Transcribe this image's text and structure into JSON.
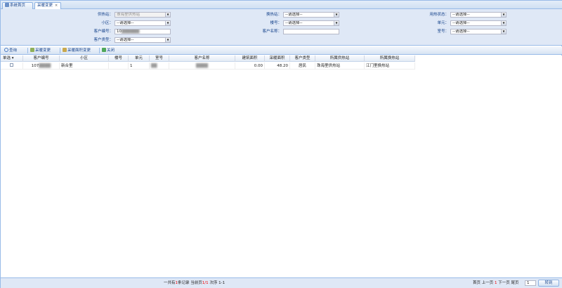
{
  "tabs": [
    {
      "label": "系统首页"
    },
    {
      "label": "采暖变更",
      "close": "×"
    }
  ],
  "form": {
    "supply_station": {
      "label": "供热站：",
      "value": "珠海里供热站"
    },
    "exchange_station": {
      "label": "换热站：",
      "value": "--请选择--"
    },
    "heating_status": {
      "label": "用热状态：",
      "value": "--请选择--"
    },
    "community": {
      "label": "小区：",
      "value": "--请选择--"
    },
    "building": {
      "label": "楼号：",
      "value": "--请选择--"
    },
    "unit": {
      "label": "单元：",
      "value": "--请选择--"
    },
    "customer_no": {
      "label": "客户编号：",
      "value": "10"
    },
    "customer_name": {
      "label": "客户名称：",
      "value": ""
    },
    "room": {
      "label": "室号：",
      "value": "--请选择--"
    },
    "customer_type": {
      "label": "客户类型：",
      "value": "--请选择--"
    }
  },
  "toolbar": {
    "query": "查询",
    "heating_change": "采暖变更",
    "heating_area_change": "采暖面积变更",
    "close": "关闭"
  },
  "grid": {
    "headers": [
      "单选",
      "客户编号",
      "小区",
      "楼号",
      "单元",
      "室号",
      "客户名称",
      "建筑面积",
      "采暖面积",
      "客户类型",
      "所属供热站",
      "所属换热站"
    ],
    "rows": [
      {
        "customer_no": "107",
        "community": "新合里",
        "building": "",
        "unit": "1",
        "room": "",
        "customer_name": "",
        "building_area": "0.00",
        "heating_area": "48.20",
        "customer_type": "居民",
        "supply_station": "珠海里供热站",
        "exchange_station": "江门里换热站"
      }
    ]
  },
  "pager": {
    "summary_prefix": "一共有",
    "total": "1",
    "summary_mid": "条记录 当前页",
    "current": "1/1",
    "summary_suffix": " 次序 1-1",
    "first": "首页",
    "prev": "上一页",
    "page": "1",
    "next": "下一页",
    "last": "尾页",
    "goto_value": "1",
    "goto": "转到"
  },
  "colors": {
    "accent": "#15428b",
    "border": "#99bbe8",
    "panel": "#dfe8f6"
  }
}
